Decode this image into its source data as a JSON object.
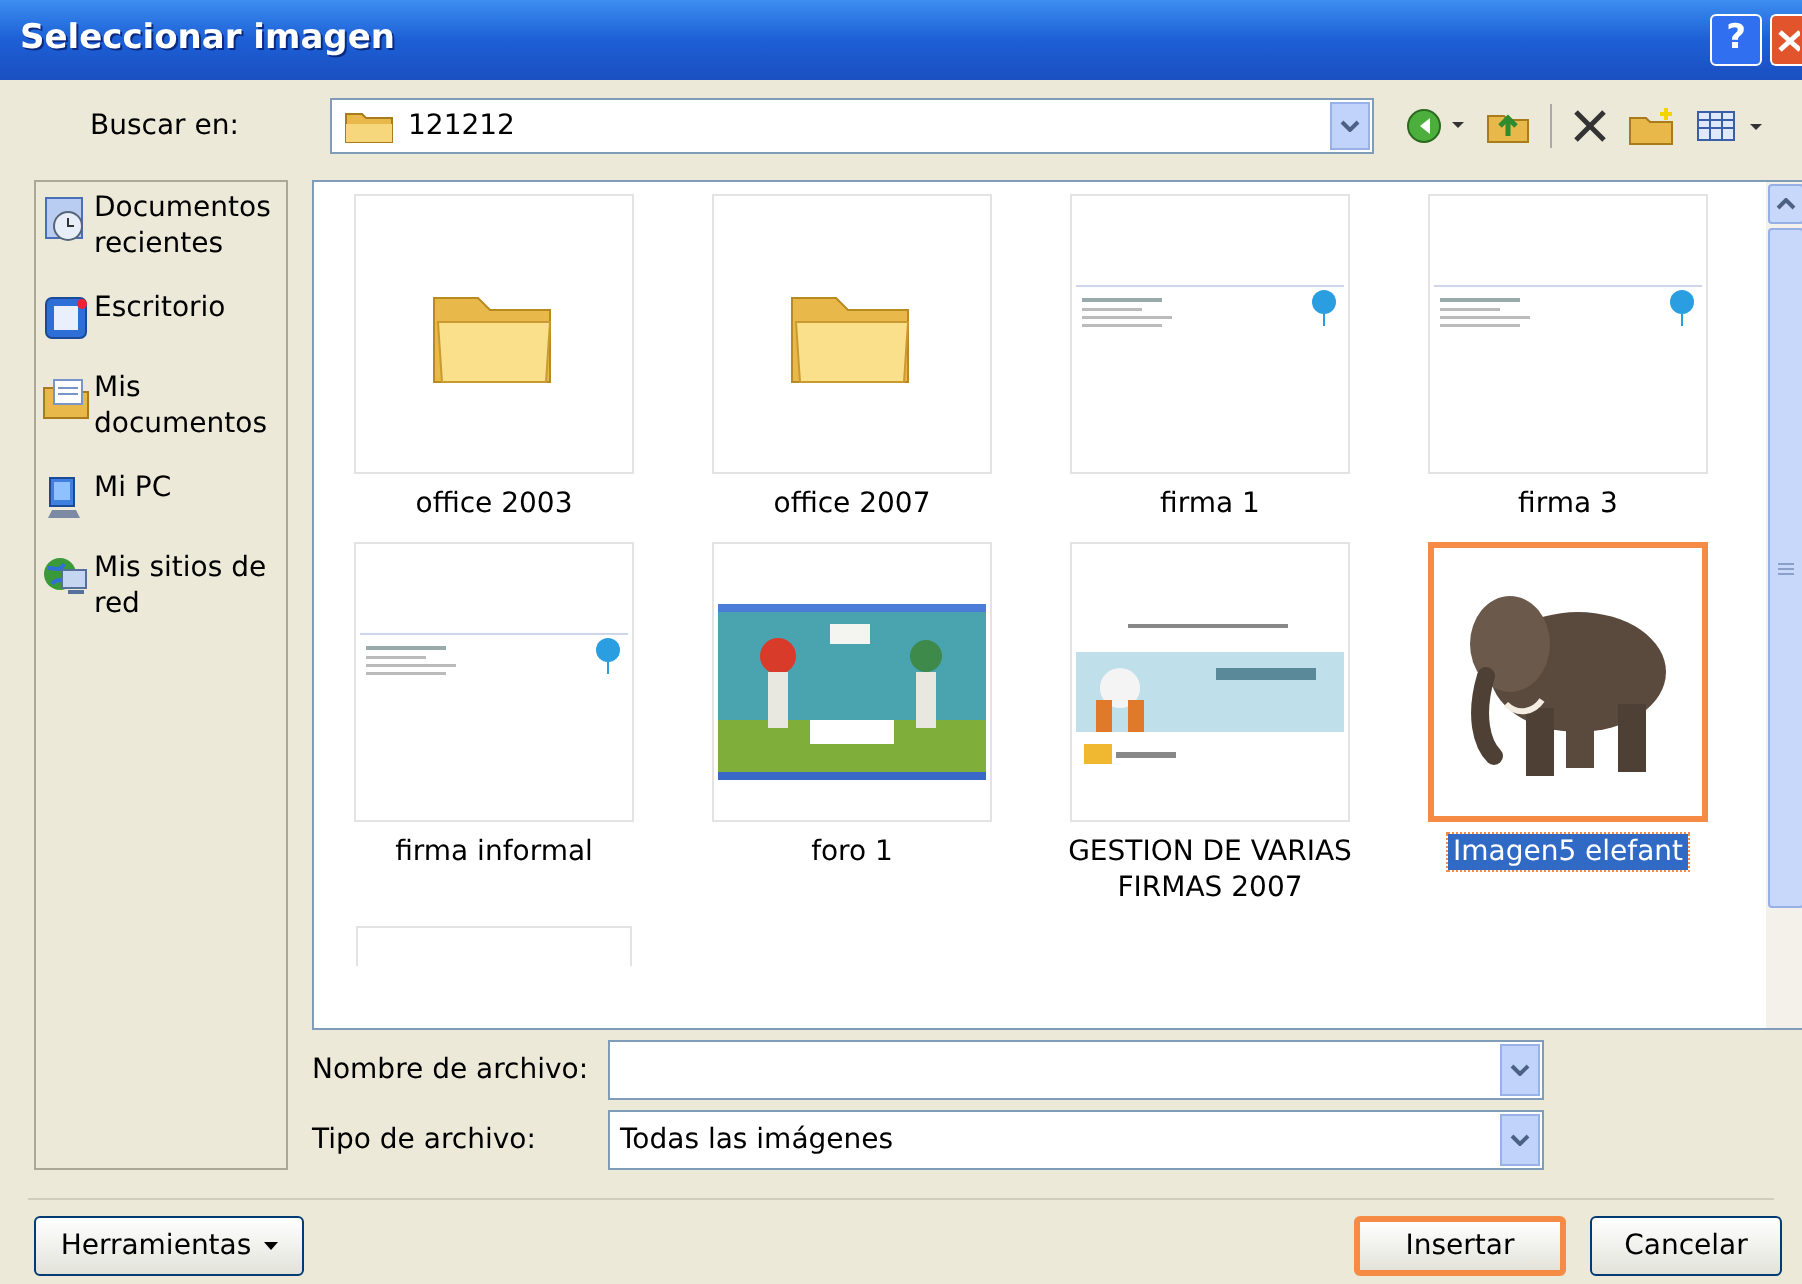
{
  "window": {
    "title": "Seleccionar imagen",
    "buttons": [
      {
        "kind": "help",
        "label": "?"
      },
      {
        "kind": "close"
      }
    ]
  },
  "look_in": {
    "label": "Buscar en:",
    "value": "121212"
  },
  "places": [
    {
      "kind": "recent",
      "label": "Documentos recientes"
    },
    {
      "kind": "desktop",
      "label": "Escritorio"
    },
    {
      "kind": "documents",
      "label": "Mis documentos"
    },
    {
      "kind": "computer",
      "label": "Mi PC"
    },
    {
      "kind": "network",
      "label": "Mis sitios de red"
    }
  ],
  "files": [
    {
      "kind": "folder",
      "label": "office 2003",
      "selected": false
    },
    {
      "kind": "folder",
      "label": "office 2007",
      "selected": false
    },
    {
      "kind": "document",
      "label": "firma 1",
      "selected": false
    },
    {
      "kind": "document",
      "label": "firma 3",
      "selected": false
    },
    {
      "kind": "document",
      "label": "firma informal",
      "selected": false
    },
    {
      "kind": "web",
      "label": "foro 1",
      "selected": false
    },
    {
      "kind": "slide",
      "label": "GESTION DE VARIAS FIRMAS 2007",
      "selected": false
    },
    {
      "kind": "animal",
      "label": "Imagen5 elefant",
      "selected": true
    },
    {
      "kind": "partial"
    }
  ],
  "file_name": {
    "label": "Nombre de archivo:"
  },
  "file_type": {
    "label": "Tipo de archivo:",
    "value": "Todas las imágenes"
  },
  "buttons": [
    {
      "kind": "tools",
      "label": "Herramientas"
    },
    {
      "kind": "default",
      "label": "Insertar"
    },
    {
      "kind": "cancel",
      "label": "Cancelar"
    }
  ]
}
